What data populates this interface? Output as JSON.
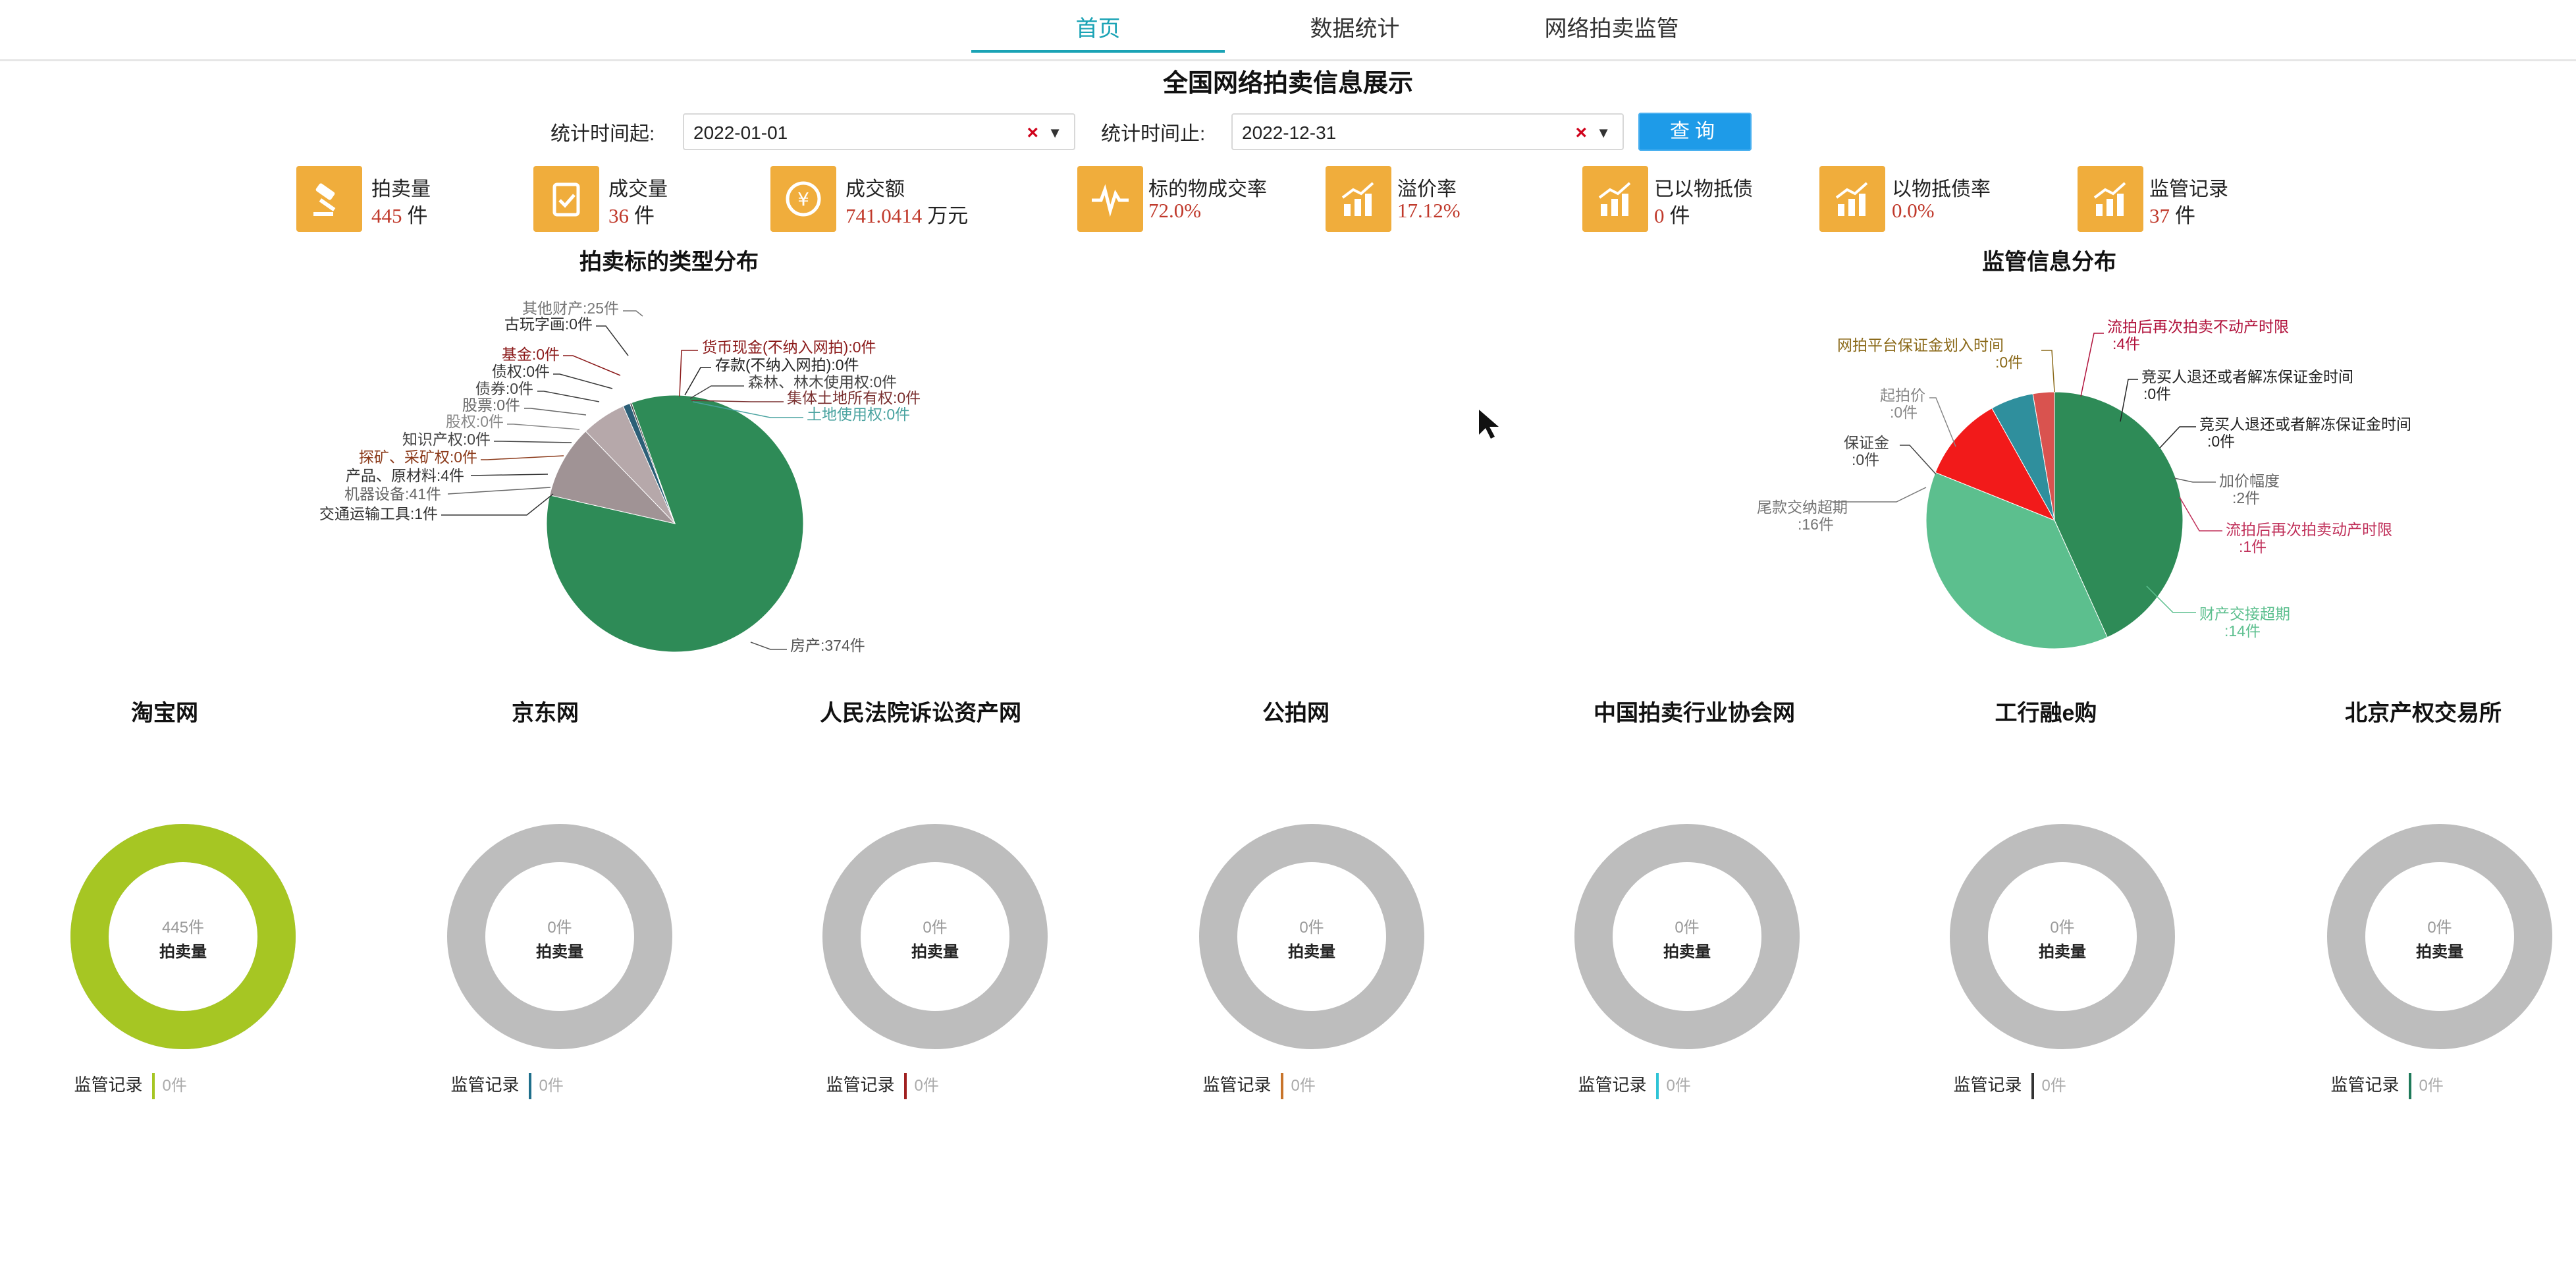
{
  "nav": {
    "tabs": [
      "首页",
      "数据统计",
      "网络拍卖监管"
    ],
    "active_index": 0
  },
  "page_title": "全国网络拍卖信息展示",
  "filter": {
    "start_label": "统计时间起:",
    "start_value": "2022-01-01",
    "end_label": "统计时间止:",
    "end_value": "2022-12-31",
    "clear_glyph": "×",
    "dropdown_glyph": "▼",
    "query_label": "查询"
  },
  "kpis": [
    {
      "label": "拍卖量",
      "value": "445",
      "unit": "件",
      "icon": "gavel-icon"
    },
    {
      "label": "成交量",
      "value": "36",
      "unit": "件",
      "icon": "checklist-icon"
    },
    {
      "label": "成交额",
      "value": "741.0414",
      "unit": "万元",
      "icon": "yuan-coin-icon"
    },
    {
      "label": "标的物成交率",
      "value": "72.0%",
      "unit": "",
      "icon": "pulse-icon"
    },
    {
      "label": "溢价率",
      "value": "17.12%",
      "unit": "",
      "icon": "bar-trend-icon"
    },
    {
      "label": "已以物抵债",
      "value": "0",
      "unit": "件",
      "icon": "bar-trend-icon"
    },
    {
      "label": "以物抵债率",
      "value": "0.0%",
      "unit": "",
      "icon": "bar-trend-icon"
    },
    {
      "label": "监管记录",
      "value": "37",
      "unit": "件",
      "icon": "bar-trend-icon"
    }
  ],
  "chart_data": [
    {
      "type": "pie",
      "title": "拍卖标的类型分布",
      "labels": [
        "房产",
        "机器设备",
        "其他财产",
        "产品、原材料",
        "交通运输工具",
        "古玩字画",
        "基金",
        "债权",
        "债券",
        "股票",
        "股权",
        "知识产权",
        "探矿、采矿权",
        "货币现金(不纳入网拍)",
        "存款(不纳入网拍)",
        "森林、林木使用权",
        "集体土地所有权",
        "土地使用权"
      ],
      "values": [
        374,
        41,
        25,
        4,
        1,
        0,
        0,
        0,
        0,
        0,
        0,
        0,
        0,
        0,
        0,
        0,
        0,
        0
      ],
      "value_unit": "件",
      "colors": {
        "房产": "#2e8b57",
        "机器设备": "#a09395",
        "其他财产": "#b6a8aa",
        "产品、原材料": "#2c5f77",
        "交通运输工具": "#4a4a4a"
      }
    },
    {
      "type": "pie",
      "title": "监管信息分布",
      "labels": [
        "尾款交纳超期",
        "财产交接超期",
        "流拍后再次拍卖不动产时限",
        "加价幅度",
        "流拍后再次拍卖动产时限",
        "网拍平台保证金划入时间",
        "竞买人退还或者解冻保证金时间",
        "竞买人退还或者解冻保证金时间",
        "起拍价",
        "保证金"
      ],
      "values": [
        16,
        14,
        4,
        2,
        1,
        0,
        0,
        0,
        0,
        0
      ],
      "value_unit": "件",
      "colors": {
        "尾款交纳超期": "#2e8b57",
        "财产交接超期": "#5cbf8e",
        "流拍后再次拍卖不动产时限": "#f21a1a",
        "加价幅度": "#2f8f9d",
        "流拍后再次拍卖动产时限": "#d9534f"
      }
    }
  ],
  "platforms": [
    {
      "name": "淘宝网",
      "count": "445件",
      "label": "拍卖量",
      "ring_color": "#a6c623",
      "record_label": "监管记录",
      "record_value": "0件",
      "bar_color": "#a6c623",
      "auction_share": 1.0
    },
    {
      "name": "京东网",
      "count": "0件",
      "label": "拍卖量",
      "ring_color": "#bdbdbd",
      "record_label": "监管记录",
      "record_value": "0件",
      "bar_color": "#1f6f8b",
      "auction_share": 0
    },
    {
      "name": "人民法院诉讼资产网",
      "count": "0件",
      "label": "拍卖量",
      "ring_color": "#bdbdbd",
      "record_label": "监管记录",
      "record_value": "0件",
      "bar_color": "#a02020",
      "auction_share": 0
    },
    {
      "name": "公拍网",
      "count": "0件",
      "label": "拍卖量",
      "ring_color": "#bdbdbd",
      "record_label": "监管记录",
      "record_value": "0件",
      "bar_color": "#c8742a",
      "auction_share": 0
    },
    {
      "name": "中国拍卖行业协会网",
      "count": "0件",
      "label": "拍卖量",
      "ring_color": "#bdbdbd",
      "record_label": "监管记录",
      "record_value": "0件",
      "bar_color": "#2ec4d6",
      "auction_share": 0
    },
    {
      "name": "工行融e购",
      "count": "0件",
      "label": "拍卖量",
      "ring_color": "#bdbdbd",
      "record_label": "监管记录",
      "record_value": "0件",
      "bar_color": "#333333",
      "auction_share": 0
    },
    {
      "name": "北京产权交易所",
      "count": "0件",
      "label": "拍卖量",
      "ring_color": "#bdbdbd",
      "record_label": "监管记录",
      "record_value": "0件",
      "bar_color": "#1f7a5a",
      "auction_share": 0
    }
  ]
}
